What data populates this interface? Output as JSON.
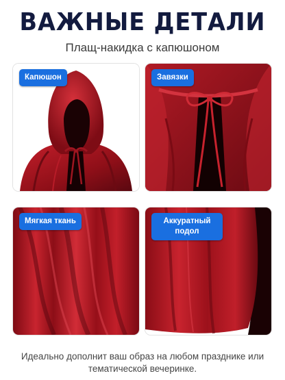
{
  "header": {
    "title": "ВАЖНЫЕ ДЕТАЛИ",
    "subtitle": "Плащ-накидка с капюшоном"
  },
  "tiles": [
    {
      "label": "Капюшон"
    },
    {
      "label": "Завязки"
    },
    {
      "label": "Мягкая ткань"
    },
    {
      "label": "Аккуратный подол"
    }
  ],
  "footer": {
    "text": "Идеально дополнит ваш образ на любом празднике или тематической вечеринке."
  },
  "colors": {
    "title": "#131b3f",
    "badge": "#1a6fe0",
    "velvet": "#a3141f",
    "velvet_dark": "#5a0810"
  }
}
